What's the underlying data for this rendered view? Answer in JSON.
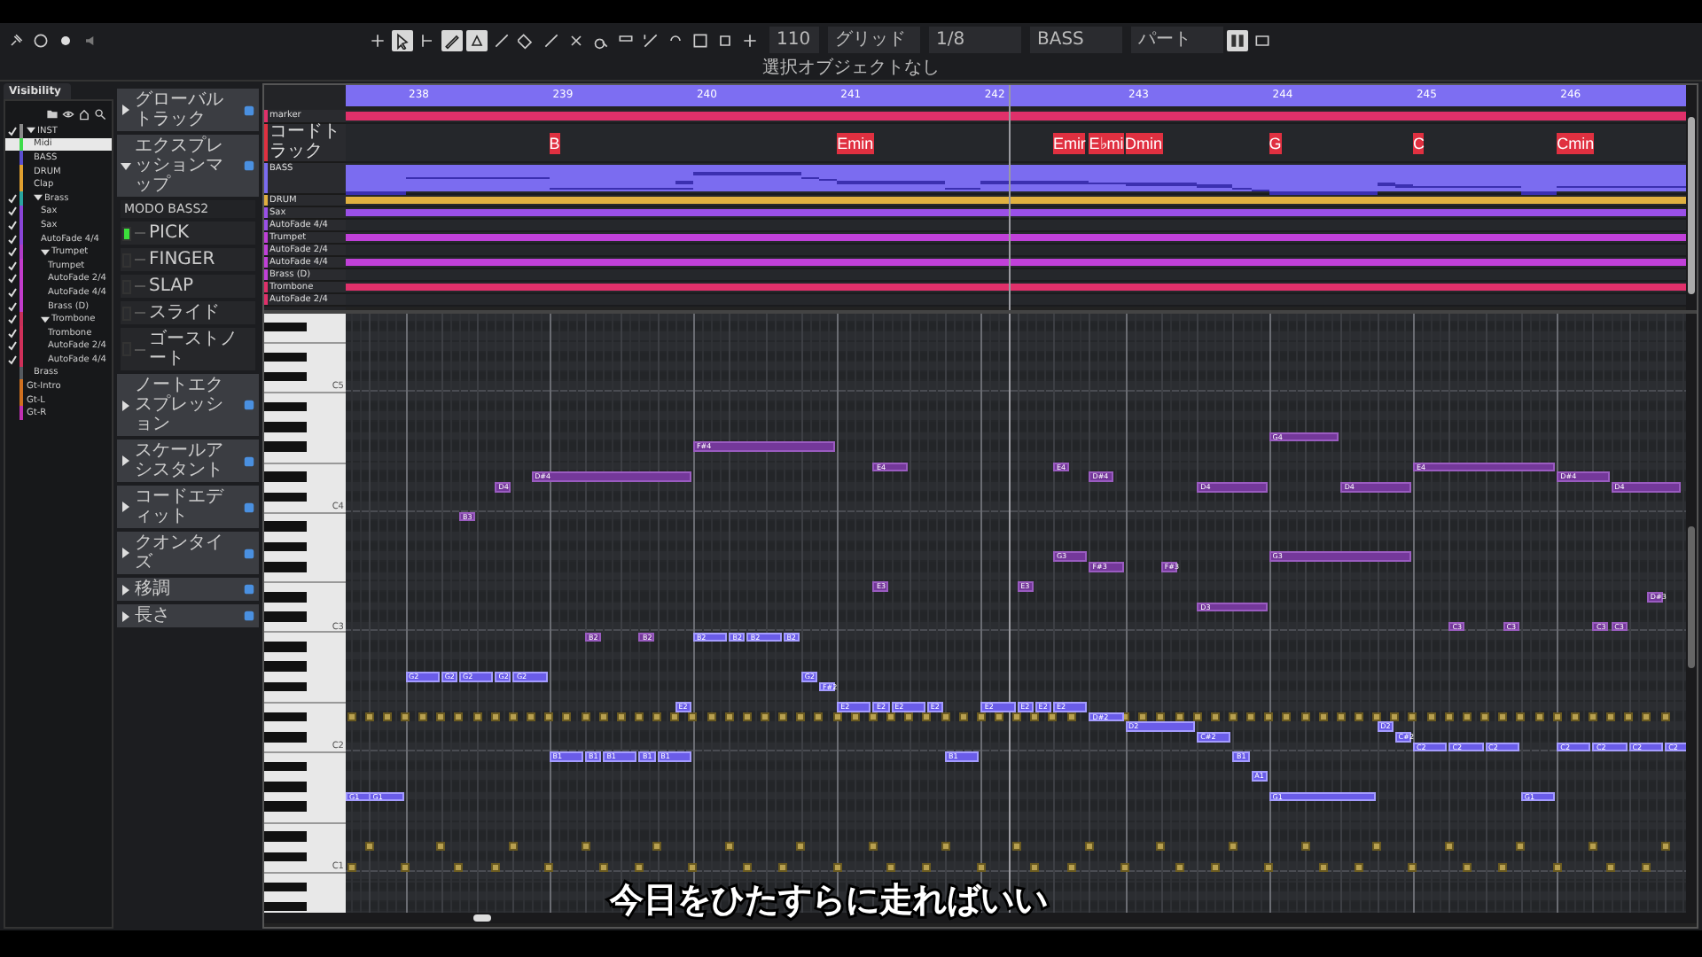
{
  "toolbar": {
    "tools": [
      {
        "selected": false
      },
      {
        "selected": true
      },
      {
        "selected": false
      },
      {
        "selected": true
      },
      {
        "selected": true
      },
      {
        "selected": false
      },
      {
        "selected": false
      },
      {
        "selected": false
      },
      {
        "selected": false
      },
      {
        "selected": false
      },
      {
        "selected": false
      },
      {
        "selected": false
      },
      {
        "selected": false
      },
      {
        "selected": false
      },
      {
        "selected": false
      },
      {
        "selected": false
      }
    ],
    "nudge": "110",
    "grid_type": "グリッド",
    "quantize": "1/8",
    "track": "BASS",
    "view": "パート"
  },
  "status_line": "選択オブジェクトなし",
  "visibility": {
    "tab": "Visibility",
    "items": [
      {
        "name": "INST",
        "checked": true,
        "selected": false,
        "expanded": true,
        "color": "#8a8a8a",
        "children": [
          {
            "name": "Midi",
            "checked": false,
            "selected": true,
            "color": "#3ddc4a"
          },
          {
            "name": "BASS",
            "checked": false,
            "selected": false,
            "color": "#5b4fd0"
          },
          {
            "name": "DRUM",
            "checked": false,
            "selected": false,
            "color": "#e0a030"
          },
          {
            "name": "Clap",
            "checked": false,
            "selected": false,
            "color": "#e0a030"
          },
          {
            "name": "Brass",
            "checked": true,
            "selected": false,
            "expanded": true,
            "color": "#2aa6a0",
            "children": [
              {
                "name": "Sax",
                "checked": true,
                "selected": false,
                "color": "#8a45d8"
              },
              {
                "name": "Sax",
                "checked": true,
                "selected": false,
                "color": "#8a45d8"
              },
              {
                "name": "AutoFade 4/4",
                "checked": true,
                "selected": false,
                "color": "#8a45d8"
              },
              {
                "name": "Trumpet",
                "checked": true,
                "selected": false,
                "expanded": true,
                "color": "#b03cc8",
                "children": [
                  {
                    "name": "Trumpet",
                    "checked": true,
                    "selected": false,
                    "color": "#c23ccc"
                  },
                  {
                    "name": "AutoFade 2/4",
                    "checked": true,
                    "selected": false,
                    "color": "#c23ccc"
                  },
                  {
                    "name": "AutoFade 4/4",
                    "checked": true,
                    "selected": false,
                    "color": "#c23ccc"
                  },
                  {
                    "name": "Brass (D)",
                    "checked": true,
                    "selected": false,
                    "color": "#c23ccc"
                  }
                ]
              },
              {
                "name": "Trombone",
                "checked": true,
                "selected": false,
                "expanded": true,
                "color": "#c8305a",
                "children": [
                  {
                    "name": "Trombone",
                    "checked": true,
                    "selected": false,
                    "color": "#d0305a"
                  },
                  {
                    "name": "AutoFade 2/4",
                    "checked": true,
                    "selected": false,
                    "color": "#d0305a"
                  },
                  {
                    "name": "AutoFade 4/4",
                    "checked": true,
                    "selected": false,
                    "color": "#d0305a"
                  }
                ]
              }
            ]
          },
          {
            "name": "Brass",
            "checked": false,
            "selected": false,
            "color": "#555a60"
          }
        ]
      },
      {
        "name": "Gt-Intro",
        "checked": false,
        "selected": false,
        "color": "#d07020"
      },
      {
        "name": "Gt-L",
        "checked": false,
        "selected": false,
        "color": "#d07020"
      },
      {
        "name": "Gt-R",
        "checked": false,
        "selected": false,
        "color": "#c030b0"
      }
    ]
  },
  "inspector": {
    "sections": [
      {
        "title": "グローバルトラック",
        "expanded": false
      },
      {
        "title": "エクスプレッションマップ",
        "expanded": true,
        "map": "MODO BASS2",
        "articulations": [
          {
            "name": "PICK",
            "selected": true
          },
          {
            "name": "FINGER",
            "selected": false
          },
          {
            "name": "SLAP",
            "selected": false
          },
          {
            "name": "スライド",
            "selected": false
          },
          {
            "name": "ゴーストノート",
            "selected": false
          }
        ]
      },
      {
        "title": "ノートエクスプレッション",
        "expanded": false
      },
      {
        "title": "スケールアシスタント",
        "expanded": false
      },
      {
        "title": "コードエディット",
        "expanded": false
      },
      {
        "title": "クオンタイズ",
        "expanded": false
      },
      {
        "title": "移調",
        "expanded": false
      },
      {
        "title": "長さ",
        "expanded": false
      }
    ]
  },
  "overview": {
    "bars": [
      "238",
      "239",
      "240",
      "241",
      "242",
      "243",
      "244",
      "245",
      "246"
    ],
    "tracks": [
      {
        "name": "marker",
        "kind": "marker",
        "color": "#e0306a"
      },
      {
        "name": "コードトラック",
        "kind": "chord",
        "color": "#e03040",
        "chords": [
          {
            "label": "B"
          },
          {
            "label": "Emin"
          },
          {
            "label": "Emir"
          },
          {
            "label": "E♭mi"
          },
          {
            "label": "Dmin"
          },
          {
            "label": "G"
          },
          {
            "label": "C"
          },
          {
            "label": "Cmin"
          }
        ]
      },
      {
        "name": "BASS",
        "kind": "notes",
        "color": "#7b6cf0"
      },
      {
        "name": "DRUM",
        "kind": "part",
        "color": "#e0b040"
      },
      {
        "name": "Sax",
        "kind": "part",
        "color": "#9a50e8"
      },
      {
        "name": "AutoFade 4/4",
        "kind": "empty",
        "color": "#9a50e8"
      },
      {
        "name": "Trumpet",
        "kind": "part",
        "color": "#c040d8"
      },
      {
        "name": "AutoFade 2/4",
        "kind": "empty",
        "color": "#c040d8"
      },
      {
        "name": "AutoFade 4/4",
        "kind": "part",
        "color": "#c040d8"
      },
      {
        "name": "Brass (D)",
        "kind": "empty",
        "color": "#c040d8"
      },
      {
        "name": "Trombone",
        "kind": "part",
        "color": "#e0306a"
      },
      {
        "name": "AutoFade 2/4",
        "kind": "empty",
        "color": "#e0306a"
      }
    ]
  },
  "keyboard": {
    "labels": [
      "C5",
      "C4",
      "C3",
      "C2",
      "C1"
    ]
  },
  "notes": [
    {
      "label": "G1",
      "kind": "bass"
    },
    {
      "label": "G1",
      "kind": "bass"
    },
    {
      "label": "G2",
      "kind": "bass"
    },
    {
      "label": "G2",
      "kind": "bass"
    },
    {
      "label": "G2",
      "kind": "bass"
    },
    {
      "label": "G2",
      "kind": "bass"
    },
    {
      "label": "G2",
      "kind": "bass"
    },
    {
      "label": "B1",
      "kind": "bass"
    },
    {
      "label": "B1",
      "kind": "bass"
    },
    {
      "label": "B1",
      "kind": "bass"
    },
    {
      "label": "B1",
      "kind": "bass"
    },
    {
      "label": "B1",
      "kind": "bass"
    },
    {
      "label": "E2",
      "kind": "bass"
    },
    {
      "label": "B2",
      "kind": "bass"
    },
    {
      "label": "B2",
      "kind": "bass"
    },
    {
      "label": "B2",
      "kind": "bass"
    },
    {
      "label": "B2",
      "kind": "bass"
    },
    {
      "label": "G2",
      "kind": "bass"
    },
    {
      "label": "F#2",
      "kind": "bass"
    },
    {
      "label": "E2",
      "kind": "bass"
    },
    {
      "label": "E2",
      "kind": "bass"
    },
    {
      "label": "E2",
      "kind": "bass"
    },
    {
      "label": "E2",
      "kind": "bass"
    },
    {
      "label": "B1",
      "kind": "bass"
    },
    {
      "label": "E2",
      "kind": "bass"
    },
    {
      "label": "E2",
      "kind": "bass"
    },
    {
      "label": "E2",
      "kind": "bass"
    },
    {
      "label": "E2",
      "kind": "bass"
    },
    {
      "label": "D#2",
      "kind": "bass"
    },
    {
      "label": "D2",
      "kind": "bass"
    },
    {
      "label": "C#2",
      "kind": "bass"
    },
    {
      "label": "B1",
      "kind": "bass"
    },
    {
      "label": "A1",
      "kind": "bass"
    },
    {
      "label": "G1",
      "kind": "bass"
    },
    {
      "label": "D2",
      "kind": "bass"
    },
    {
      "label": "C#2",
      "kind": "bass"
    },
    {
      "label": "C2",
      "kind": "bass"
    },
    {
      "label": "C2",
      "kind": "bass"
    },
    {
      "label": "C2",
      "kind": "bass"
    },
    {
      "label": "G1",
      "kind": "bass"
    },
    {
      "label": "C2",
      "kind": "bass"
    },
    {
      "label": "C2",
      "kind": "bass"
    },
    {
      "label": "C2",
      "kind": "bass"
    },
    {
      "label": "C2",
      "kind": "bass"
    },
    {
      "label": "B3",
      "kind": "lead"
    },
    {
      "label": "D4",
      "kind": "lead"
    },
    {
      "label": "D#4",
      "kind": "lead"
    },
    {
      "label": "B2",
      "kind": "lead"
    },
    {
      "label": "B2",
      "kind": "lead"
    },
    {
      "label": "F#4",
      "kind": "lead"
    },
    {
      "label": "E4",
      "kind": "lead"
    },
    {
      "label": "E3",
      "kind": "lead"
    },
    {
      "label": "E3",
      "kind": "lead"
    },
    {
      "label": "E4",
      "kind": "lead"
    },
    {
      "label": "D#4",
      "kind": "lead"
    },
    {
      "label": "G3",
      "kind": "lead"
    },
    {
      "label": "F#3",
      "kind": "lead"
    },
    {
      "label": "F#3",
      "kind": "lead"
    },
    {
      "label": "D4",
      "kind": "lead"
    },
    {
      "label": "D3",
      "kind": "lead"
    },
    {
      "label": "G4",
      "kind": "lead"
    },
    {
      "label": "G3",
      "kind": "lead"
    },
    {
      "label": "D4",
      "kind": "lead"
    },
    {
      "label": "E4",
      "kind": "lead"
    },
    {
      "label": "C3",
      "kind": "lead"
    },
    {
      "label": "C3",
      "kind": "lead"
    },
    {
      "label": "D#4",
      "kind": "lead"
    },
    {
      "label": "C3",
      "kind": "lead"
    },
    {
      "label": "C3",
      "kind": "lead"
    },
    {
      "label": "D4",
      "kind": "lead"
    },
    {
      "label": "D#3",
      "kind": "lead"
    }
  ],
  "subtitle": "今日をひたすらに走ればいい"
}
